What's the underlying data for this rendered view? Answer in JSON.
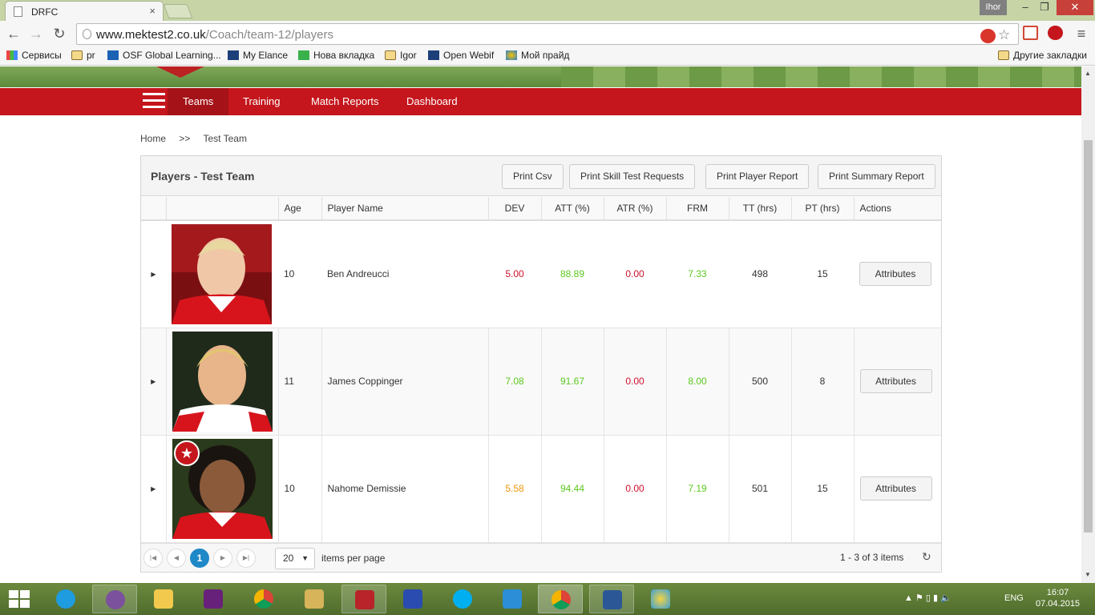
{
  "browser": {
    "tab_title": "DRFC",
    "tab_close": "×",
    "user_name": "Ihor",
    "url_host": "www.mektest2.co.uk",
    "url_path": "/Coach/team-12/players",
    "bookmarks": [
      "Сервисы",
      "pr",
      "OSF Global Learning...",
      "My Elance",
      "Нова вкладка",
      "Igor",
      "Open Webif",
      "Мой прайд"
    ],
    "other_bookmarks": "Другие закладки"
  },
  "nav": {
    "items": [
      "Teams",
      "Training",
      "Match Reports",
      "Dashboard"
    ],
    "active": "Teams"
  },
  "breadcrumb": {
    "home": "Home",
    "sep": ">>",
    "current": "Test Team"
  },
  "grid": {
    "title": "Players - Test Team",
    "buttons": [
      "Print Csv",
      "Print Skill Test Requests",
      "Print Player Report",
      "Print Summary Report"
    ],
    "columns": [
      "",
      "",
      "Age",
      "Player Name",
      "DEV",
      "ATT (%)",
      "ATR (%)",
      "FRM",
      "TT (hrs)",
      "PT (hrs)",
      "Actions"
    ],
    "rows": [
      {
        "age": "10",
        "name": "Ben Andreucci",
        "dev": "5.00",
        "att": "88.89",
        "atr": "0.00",
        "frm": "7.33",
        "tt": "498",
        "pt": "15",
        "action": "Attributes"
      },
      {
        "age": "11",
        "name": "James Coppinger",
        "dev": "7.08",
        "att": "91.67",
        "atr": "0.00",
        "frm": "8.00",
        "tt": "500",
        "pt": "8",
        "action": "Attributes"
      },
      {
        "age": "10",
        "name": "Nahome Demissie",
        "dev": "5.58",
        "att": "94.44",
        "atr": "0.00",
        "frm": "7.19",
        "tt": "501",
        "pt": "15",
        "action": "Attributes"
      }
    ],
    "colors": {
      "red": "#d0102c",
      "green": "#5cc81e",
      "orange": "#f0960a"
    }
  },
  "pager": {
    "current_page": "1",
    "page_size": "20",
    "page_size_label": "items per page",
    "info": "1 - 3 of 3 items"
  },
  "taskbar": {
    "lang": "ENG",
    "time": "16:07",
    "date": "07.04.2015"
  },
  "theme": {
    "nav_red": "#c4161c",
    "pager_blue": "#1f88c7"
  }
}
